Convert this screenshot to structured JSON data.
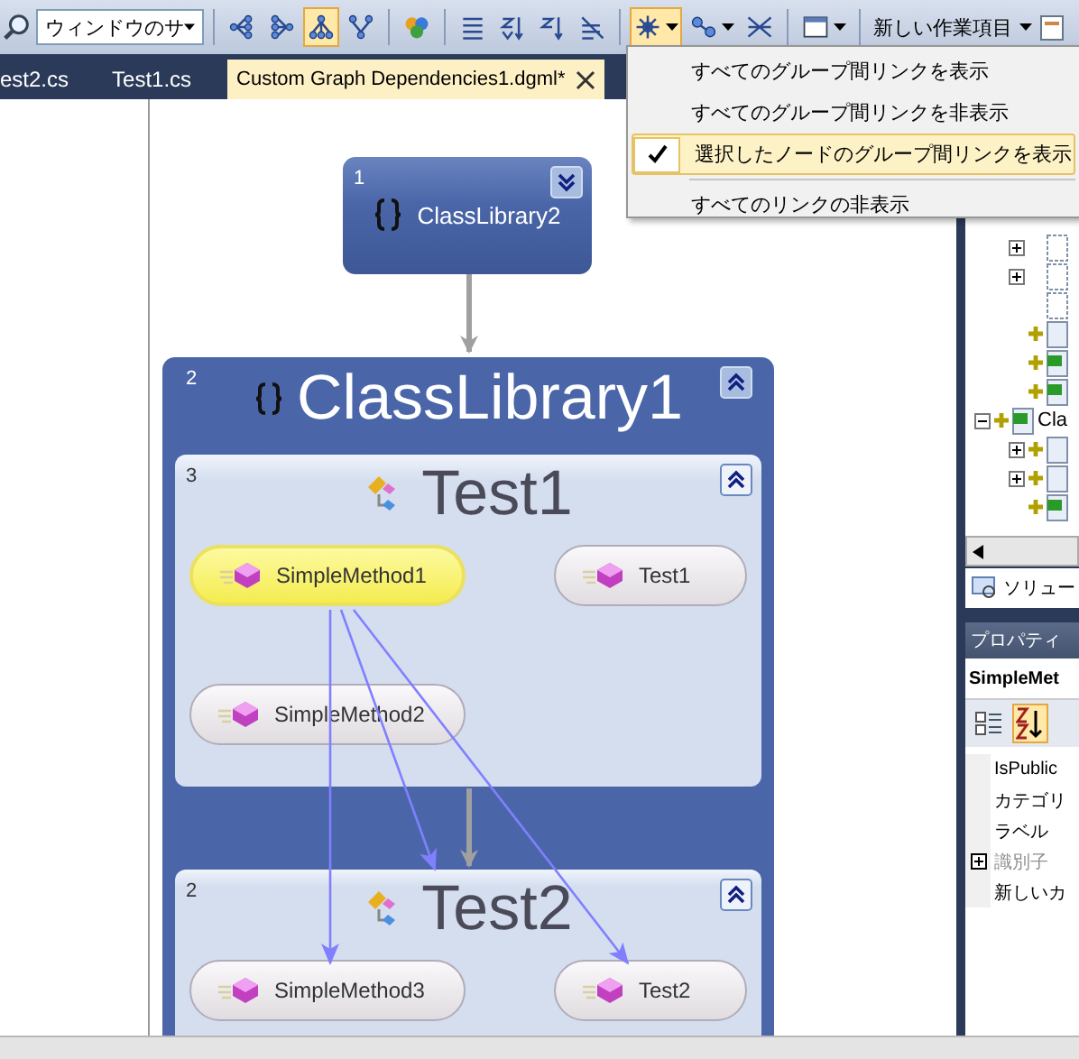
{
  "toolbar": {
    "zoom_combo": "ウィンドウのサ",
    "new_work_item": "新しい作業項目",
    "buttons": [
      {
        "kind": "layout-left",
        "selected": false
      },
      {
        "kind": "layout-right",
        "selected": false
      },
      {
        "kind": "layout-top",
        "selected": true
      },
      {
        "kind": "layout-bottom",
        "selected": false
      },
      {
        "kind": "legend",
        "selected": false
      },
      {
        "kind": "grid",
        "selected": false
      },
      {
        "kind": "sort-az",
        "selected": false
      },
      {
        "kind": "sort-za",
        "selected": false
      },
      {
        "kind": "clear",
        "selected": false
      },
      {
        "kind": "links",
        "selected": true
      },
      {
        "kind": "cluster",
        "selected": false
      },
      {
        "kind": "butterfly",
        "selected": false
      },
      {
        "kind": "window",
        "selected": false
      }
    ]
  },
  "tabs": [
    {
      "label": "est2.cs",
      "selected": false
    },
    {
      "label": "Test1.cs",
      "selected": false
    },
    {
      "label": "Custom Graph Dependencies1.dgml*",
      "selected": true
    }
  ],
  "menu": {
    "items": [
      {
        "label": "すべてのグループ間リンクを表示",
        "checked": false
      },
      {
        "label": "すべてのグループ間リンクを非表示",
        "checked": false
      },
      {
        "label": "選択したノードのグループ間リンクを表示",
        "checked": true
      },
      {
        "label": "すべてのリンクの非表示",
        "checked": false
      }
    ]
  },
  "graph": {
    "top_node": {
      "number": "1",
      "label": "ClassLibrary2",
      "expanded": false
    },
    "group": {
      "number": "2",
      "label": "ClassLibrary1",
      "expanded": true,
      "children": [
        {
          "number": "3",
          "label": "Test1",
          "expanded": true,
          "children": [
            {
              "label": "SimpleMethod1",
              "selected": true
            },
            {
              "label": "Test1",
              "selected": false
            },
            {
              "label": "SimpleMethod2",
              "selected": false
            }
          ]
        },
        {
          "number": "2",
          "label": "Test2",
          "expanded": true,
          "children": [
            {
              "label": "SimpleMethod3",
              "selected": false
            },
            {
              "label": "Test2",
              "selected": false
            }
          ]
        }
      ]
    }
  },
  "solution_tree": [
    {
      "kind": "folder",
      "expanded": false
    },
    {
      "kind": "folder",
      "expanded": false
    },
    {
      "kind": "file"
    },
    {
      "kind": "diagram"
    },
    {
      "kind": "code"
    },
    {
      "kind": "code"
    },
    {
      "kind": "project",
      "label": "Cla",
      "expanded": true,
      "children": [
        {
          "kind": "references",
          "expanded": false
        },
        {
          "kind": "folder",
          "expanded": false
        },
        {
          "kind": "code"
        }
      ]
    }
  ],
  "solution_tab": {
    "label": "ソリュー"
  },
  "properties": {
    "title": "プロパティ",
    "object": "SimpleMet",
    "rows": [
      {
        "name": "IsPublic",
        "disabled": false
      },
      {
        "name": "カテゴリ",
        "disabled": false
      },
      {
        "name": "ラベル",
        "disabled": false
      },
      {
        "name": "識別子",
        "disabled": true,
        "expanded": false
      },
      {
        "name": "新しいカ",
        "disabled": false
      }
    ]
  }
}
